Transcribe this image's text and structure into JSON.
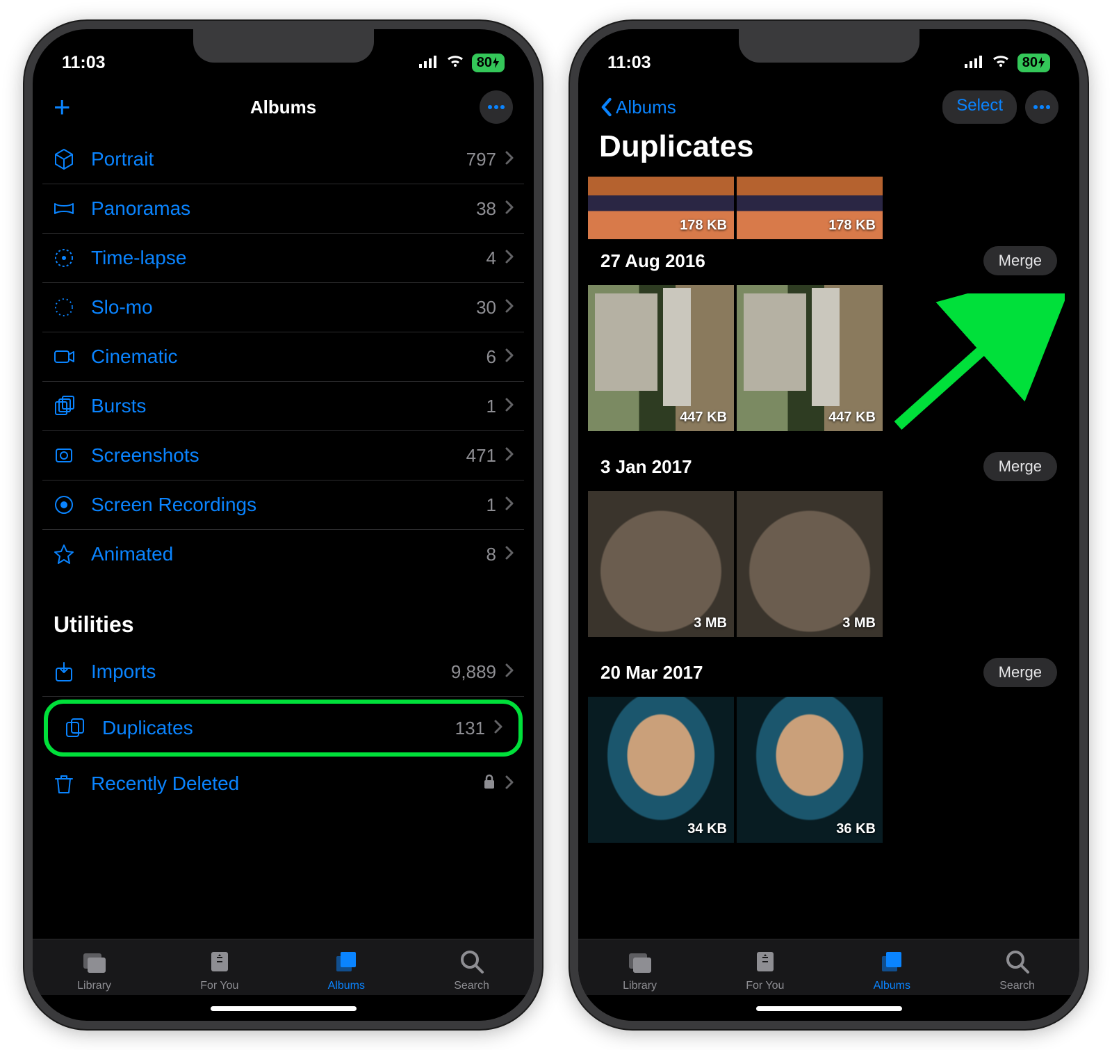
{
  "status": {
    "time": "11:03",
    "battery": "80"
  },
  "left": {
    "title": "Albums",
    "media_types": [
      {
        "icon": "cube",
        "label": "Portrait",
        "count": "797"
      },
      {
        "icon": "pano",
        "label": "Panoramas",
        "count": "38"
      },
      {
        "icon": "timelapse",
        "label": "Time-lapse",
        "count": "4"
      },
      {
        "icon": "slomo",
        "label": "Slo-mo",
        "count": "30"
      },
      {
        "icon": "cinematic",
        "label": "Cinematic",
        "count": "6"
      },
      {
        "icon": "bursts",
        "label": "Bursts",
        "count": "1"
      },
      {
        "icon": "screenshots",
        "label": "Screenshots",
        "count": "471"
      },
      {
        "icon": "recordings",
        "label": "Screen Recordings",
        "count": "1"
      },
      {
        "icon": "animated",
        "label": "Animated",
        "count": "8"
      }
    ],
    "utilities_title": "Utilities",
    "utilities": [
      {
        "icon": "imports",
        "label": "Imports",
        "count": "9,889",
        "lock": false
      },
      {
        "icon": "duplicates",
        "label": "Duplicates",
        "count": "131",
        "lock": false,
        "highlight": true
      },
      {
        "icon": "trash",
        "label": "Recently Deleted",
        "count": "",
        "lock": true
      }
    ]
  },
  "right": {
    "back_label": "Albums",
    "select_label": "Select",
    "title": "Duplicates",
    "merge_label": "Merge",
    "top_partial": {
      "sizes": [
        "178 KB",
        "178 KB"
      ]
    },
    "groups": [
      {
        "date": "27 Aug 2016",
        "art": "art2",
        "sizes": [
          "447 KB",
          "447 KB"
        ]
      },
      {
        "date": "3 Jan 2017",
        "art": "art3",
        "sizes": [
          "3 MB",
          "3 MB"
        ]
      },
      {
        "date": "20 Mar 2017",
        "art": "art4",
        "sizes": [
          "34 KB",
          "36 KB"
        ]
      }
    ]
  },
  "tabs": [
    {
      "label": "Library"
    },
    {
      "label": "For You"
    },
    {
      "label": "Albums",
      "active": true
    },
    {
      "label": "Search"
    }
  ]
}
